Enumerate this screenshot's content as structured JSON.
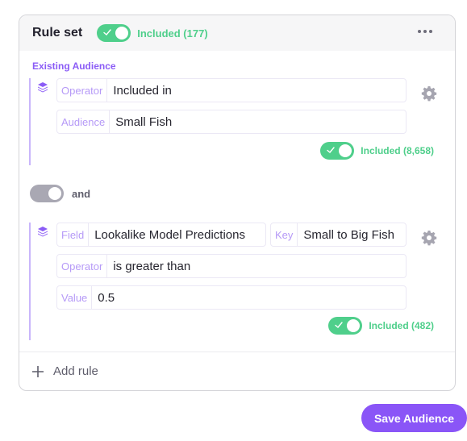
{
  "rule_set": {
    "title": "Rule set",
    "toggle_on": true,
    "included_label": "Included (177)",
    "more_icon": "ellipsis-icon"
  },
  "existing_audience": {
    "section_label": "Existing Audience",
    "operator": {
      "label": "Operator",
      "value": "Included in"
    },
    "audience": {
      "label": "Audience",
      "value": "Small Fish"
    },
    "toggle_on": true,
    "included_label": "Included (8,658)"
  },
  "combinator": {
    "toggle_on": false,
    "label": "and"
  },
  "field_rule": {
    "field": {
      "label": "Field",
      "value": "Lookalike Model Predictions"
    },
    "key": {
      "label": "Key",
      "value": "Small to Big Fish"
    },
    "operator": {
      "label": "Operator",
      "value": "is greater than"
    },
    "value": {
      "label": "Value",
      "value": "0.5"
    },
    "toggle_on": true,
    "included_label": "Included (482)"
  },
  "add_rule_label": "Add rule",
  "save_button_label": "Save Audience",
  "colors": {
    "accent": "#8a55f7",
    "success": "#4fcf8b",
    "field_label": "#b69af7",
    "rule_border": "#c9b6fb"
  }
}
